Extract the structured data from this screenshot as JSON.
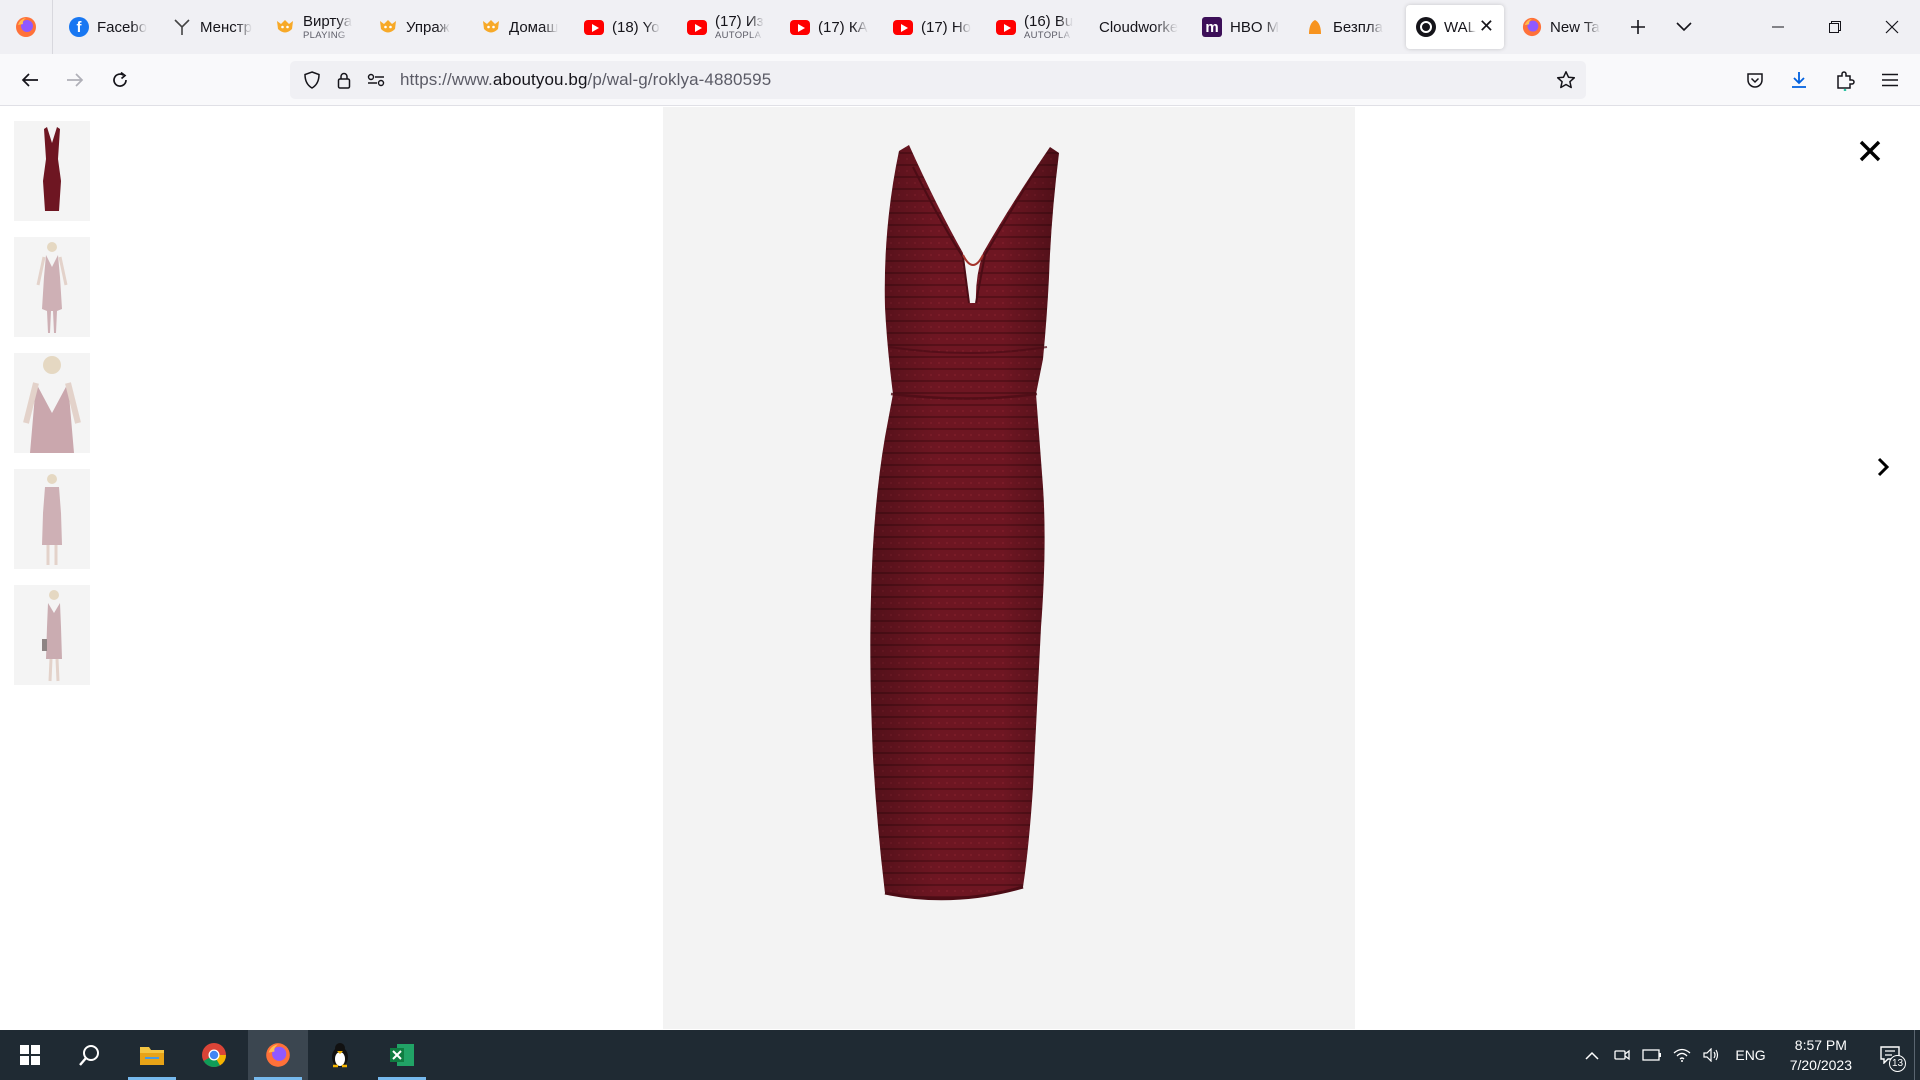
{
  "browser": {
    "tabs": [
      {
        "title": "Facebo",
        "subtitle": "",
        "icon": "facebook-icon"
      },
      {
        "title": "Менстр",
        "subtitle": "",
        "icon": "filter-funnel-icon"
      },
      {
        "title": "Виртуа",
        "subtitle": "PLAYING",
        "icon": "fox-sticker-icon"
      },
      {
        "title": "Упраж",
        "subtitle": "",
        "icon": "fox-sticker-icon"
      },
      {
        "title": "Домаш",
        "subtitle": "",
        "icon": "fox-sticker-icon"
      },
      {
        "title": "(18) Yo",
        "subtitle": "",
        "icon": "youtube-icon"
      },
      {
        "title": "(17) Из",
        "subtitle": "AUTOPLA",
        "icon": "youtube-icon"
      },
      {
        "title": "(17) КА",
        "subtitle": "",
        "icon": "youtube-icon"
      },
      {
        "title": "(17) Но",
        "subtitle": "",
        "icon": "youtube-icon"
      },
      {
        "title": "(16) Bu",
        "subtitle": "AUTOPLA",
        "icon": "youtube-icon"
      },
      {
        "title": "Cloudworke",
        "subtitle": "",
        "icon": "none"
      },
      {
        "title": "HBO M",
        "subtitle": "",
        "icon": "hbo-max-icon"
      },
      {
        "title": "Безпла",
        "subtitle": "",
        "icon": "orange-bell-icon"
      },
      {
        "title": "WAL",
        "subtitle": "",
        "icon": "aboutyou-icon",
        "active": true
      },
      {
        "title": "New Ta",
        "subtitle": "",
        "icon": "firefox-icon"
      }
    ],
    "url_prefix": "https://www.",
    "url_host": "aboutyou.bg",
    "url_path": "/p/wal-g/roklya-4880595"
  },
  "gallery": {
    "thumbnail_count": 5,
    "selected_index": 0
  },
  "taskbar": {
    "language": "ENG",
    "time": "8:57 PM",
    "date": "7/20/2023",
    "notification_count": "13"
  },
  "colors": {
    "dress": "#6e1622",
    "stage_background": "#f3f3f3",
    "taskbar": "#1f2a33",
    "tab_strip": "#f0f0f4"
  }
}
